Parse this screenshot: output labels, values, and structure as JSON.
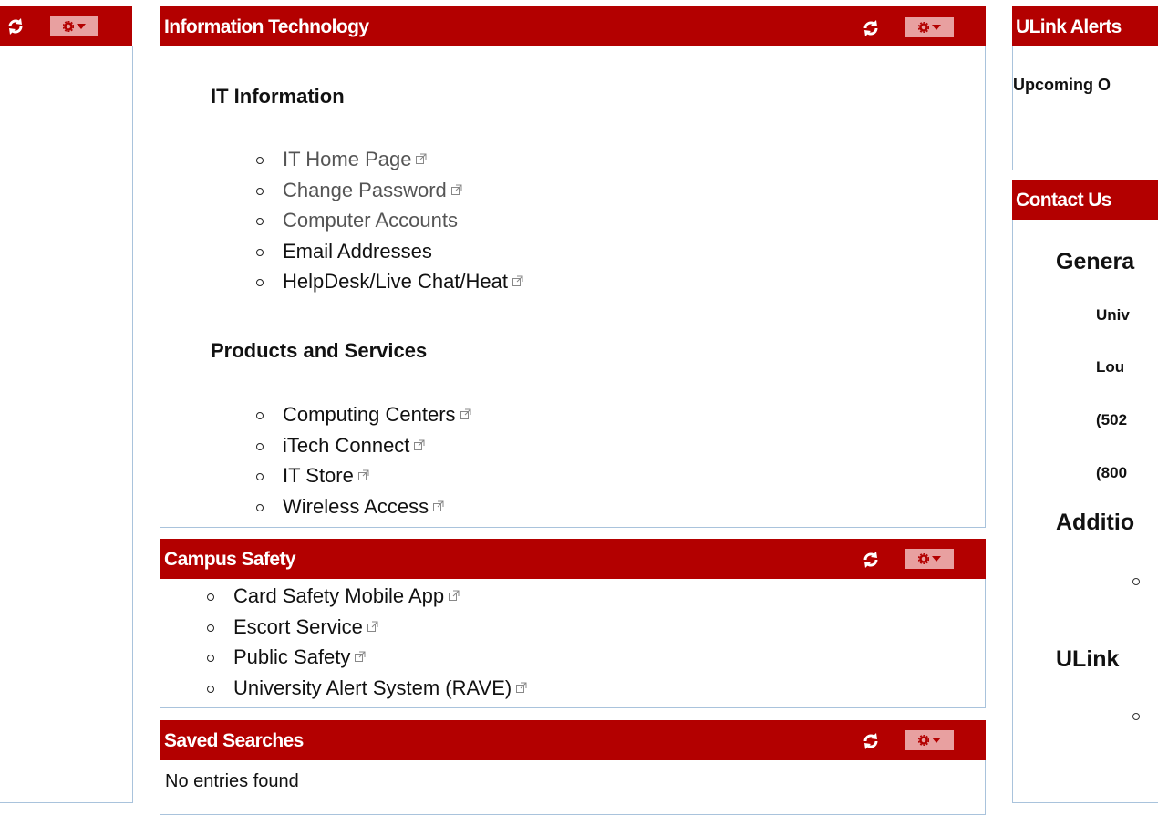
{
  "colors": {
    "header_bg": "#b30000",
    "border": "#a9c3dc",
    "gear_bg": "#e8a0a0"
  },
  "icons": {
    "refresh": "refresh-icon",
    "gear": "gear-icon",
    "dropdown": "caret-down-icon",
    "external": "external-link-icon"
  },
  "it_portlet": {
    "title": "Information Technology",
    "sections": [
      {
        "heading": "IT Information",
        "links": [
          {
            "label": "IT Home Page",
            "external": true
          },
          {
            "label": "Change Password",
            "external": true
          },
          {
            "label": "Computer Accounts",
            "external": false
          },
          {
            "label": "Email Addresses",
            "external": false
          },
          {
            "label": "HelpDesk/Live Chat/Heat",
            "external": true
          }
        ]
      },
      {
        "heading": "Products and Services",
        "links": [
          {
            "label": "Computing Centers",
            "external": true
          },
          {
            "label": "iTech Connect",
            "external": true
          },
          {
            "label": "IT Store",
            "external": true
          },
          {
            "label": "Wireless Access",
            "external": true
          }
        ]
      }
    ]
  },
  "safety_portlet": {
    "title": "Campus Safety",
    "links": [
      {
        "label": "Card Safety Mobile App",
        "external": true
      },
      {
        "label": "Escort Service",
        "external": true
      },
      {
        "label": "Public Safety",
        "external": true
      },
      {
        "label": "University Alert System (RAVE)",
        "external": true
      }
    ]
  },
  "saved_searches_portlet": {
    "title": "Saved Searches",
    "empty_text": "No entries found"
  },
  "alerts_portlet": {
    "title": "ULink Alerts",
    "upcoming": "Upcoming O"
  },
  "contact_portlet": {
    "title": "Contact Us",
    "general_heading": "Genera",
    "lines": [
      "Univ",
      "Lou",
      "(502",
      "(800"
    ],
    "additional_heading": "Additio",
    "ulink_heading": "ULink"
  }
}
